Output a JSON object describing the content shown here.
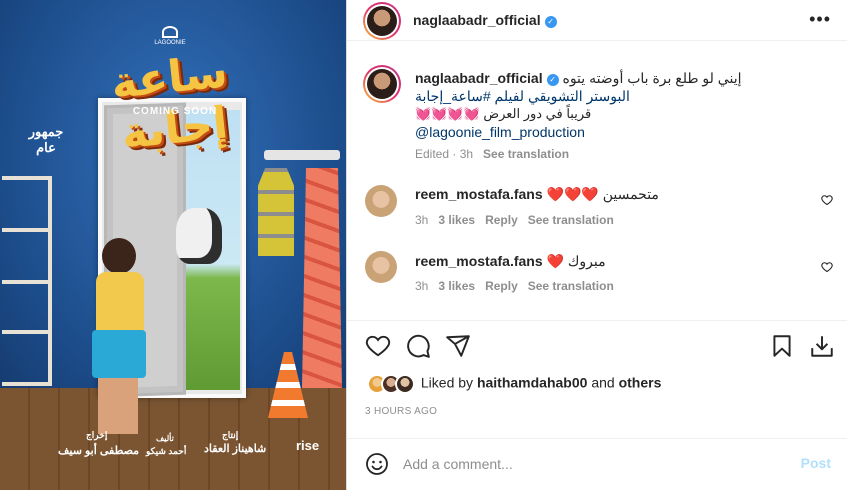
{
  "poster": {
    "logo_text": "LAGOONIE",
    "title_text": "ساعة إجابة",
    "coming_soon": "COMING SOON",
    "rating": "جمهور عام",
    "credits": {
      "directed_by_label": "إخراج",
      "director": "مصطفى أبو سيف",
      "produced_by_label": "إنتاج",
      "producer": "شاهيناز العقاد",
      "writer_label": "تأليف",
      "writer": "أحمد شيكو",
      "distributor": "rise"
    }
  },
  "header": {
    "username": "naglaabadr_official",
    "verified": true,
    "more_icon": "more-options-icon"
  },
  "caption": {
    "username": "naglaabadr_official",
    "line1": "إيني لو طلع برة باب أوضته يتوه",
    "line2": "البوستر التشويقي لفيلم #ساعة_إجابة",
    "line3": "قريباً في دور العرض 💓💓💓💓",
    "mention": "@lagoonie_film_production",
    "edited": "Edited · 3h",
    "see_translation": "See translation"
  },
  "comments": [
    {
      "username": "reem_mostafa.fans",
      "text": "متحمسين ❤️❤️❤️",
      "time": "3h",
      "likes": "3 likes",
      "reply": "Reply",
      "see_translation": "See translation"
    },
    {
      "username": "reem_mostafa.fans",
      "text": "مبروك ❤️",
      "time": "3h",
      "likes": "3 likes",
      "reply": "Reply",
      "see_translation": "See translation"
    }
  ],
  "actions": {
    "like_icon": "heart-icon",
    "comment_icon": "comment-icon",
    "share_icon": "share-icon",
    "save_icon": "bookmark-icon",
    "download_icon": "download-icon"
  },
  "likes": {
    "prefix": "Liked by",
    "user": "haithamdahab00",
    "and": "and",
    "others": "others"
  },
  "timestamp": "3 HOURS AGO",
  "add_comment": {
    "placeholder": "Add a comment...",
    "post_label": "Post",
    "emoji_icon": "emoji-icon"
  },
  "colors": {
    "verified_blue": "#3897f0",
    "link": "#00376b",
    "muted": "#8e8e8e",
    "post_disabled": "#b2dffc",
    "heart_red": "#ed4956"
  }
}
